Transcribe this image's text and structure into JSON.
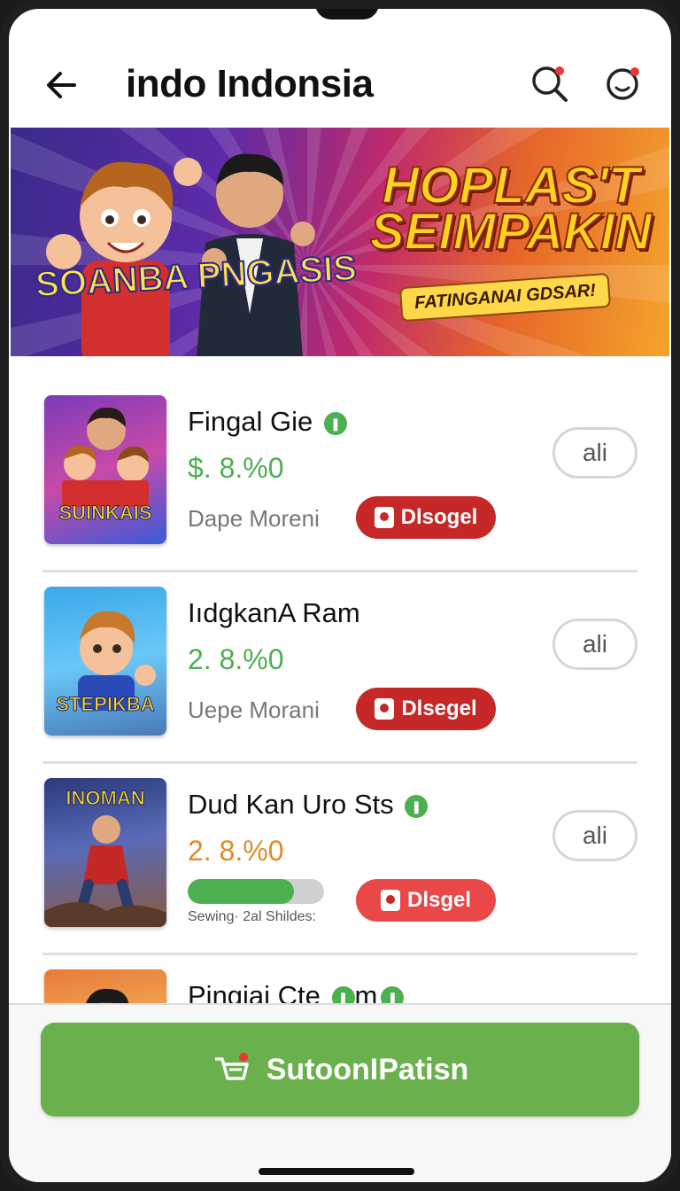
{
  "header": {
    "title": "indo Indonsia"
  },
  "banner": {
    "game_logo": "SOANBA PNGASIS",
    "promo_title": "HOPLAS'T SEIMPAKIN",
    "promo_subtitle": "FATINGANAI GDSAR!"
  },
  "items": [
    {
      "thumb_label": "SUINKAIS",
      "name": "Fingal Gie",
      "price": "$. 8.%0",
      "price_color": "#4caf50",
      "meta": "Dape Moreni",
      "action_label": "Dlsogel",
      "pill_label": "ali"
    },
    {
      "thumb_label": "STEPIKBA",
      "name": "IıdgkanA Ram",
      "price": "2. 8.%0",
      "price_color": "#4caf50",
      "meta": "Uepe Morani",
      "action_label": "Dlsegel",
      "pill_label": "ali"
    },
    {
      "thumb_label": "INOMAN",
      "name": "Dud Kan Uro Sts",
      "price": "2. 8.%0",
      "price_color": "#e08a2a",
      "progress_fraction": 0.78,
      "progress_label": "Sewing· 2al Shildes:",
      "action_label": "Dlsgel",
      "pill_label": "ali"
    },
    {
      "name": "Pingiai Cte",
      "name_suffix": "m"
    }
  ],
  "cta": {
    "label": "SutoonIPatisn"
  },
  "colors": {
    "accent_green": "#6ab04c",
    "action_red": "#c62828"
  },
  "icons": {
    "back": "arrow-left-icon",
    "search": "search-icon",
    "chat": "chat-icon",
    "cart": "cart-icon"
  }
}
